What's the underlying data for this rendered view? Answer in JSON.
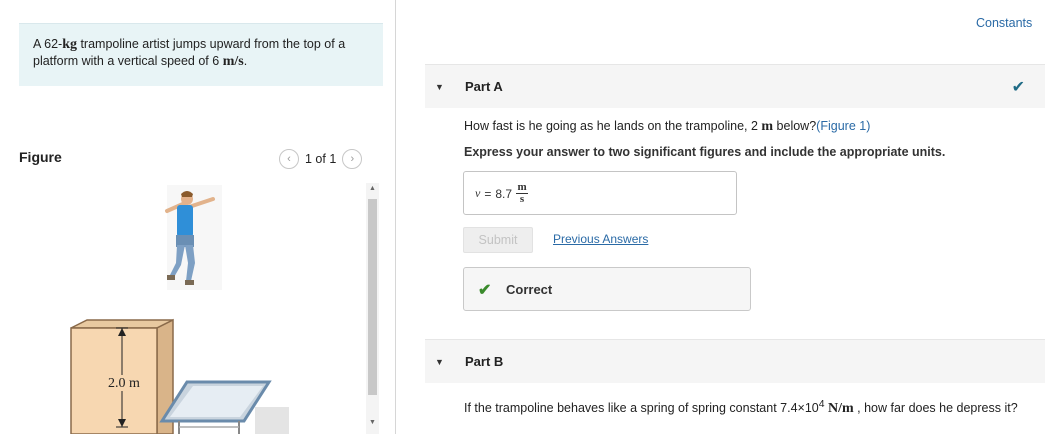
{
  "problem": {
    "pre": "A 62-",
    "mass_unit": "kg",
    "mid": " trampoline artist jumps upward from the top of a platform with a vertical speed of 6 ",
    "speed_unit": "m/s",
    "post": "."
  },
  "figure": {
    "title": "Figure",
    "pager_text": "1 of 1",
    "prev_icon": "‹",
    "next_icon": "›",
    "height_label": "2.0 m"
  },
  "constants_link": "Constants",
  "partA": {
    "title": "Part A",
    "question_pre": "How fast is he going as he lands on the trampoline, 2 ",
    "question_unit": "m",
    "question_mid": " below?",
    "figure_link": "(Figure 1)",
    "instructions": "Express your answer to two significant figures and include the appropriate units.",
    "answer_var": "v",
    "answer_eq": " = ",
    "answer_value": "8.7",
    "answer_unit_num": "m",
    "answer_unit_den": "s",
    "submit_label": "Submit",
    "previous_answers": "Previous Answers",
    "result_text": "Correct",
    "status_color": "#1f6b86",
    "correct_color": "#3a8a2c"
  },
  "partB": {
    "title": "Part B",
    "text_pre": "If the trampoline behaves like a spring of spring constant 7.4×10",
    "text_exp": "4",
    "text_unit": "N/m",
    "text_post": " , how far does he depress it?"
  }
}
